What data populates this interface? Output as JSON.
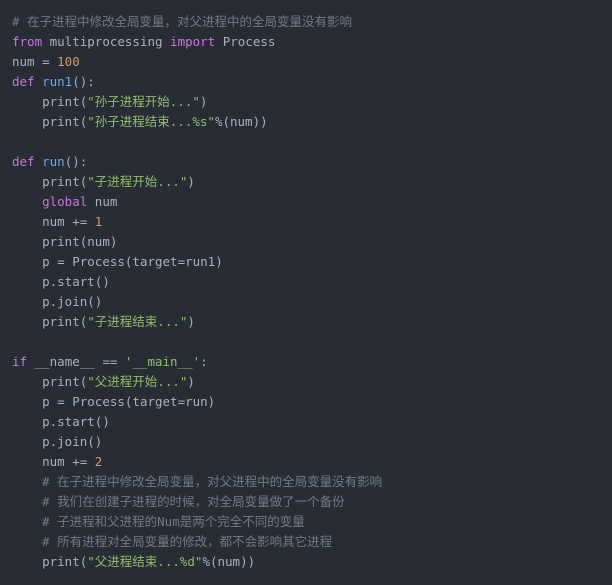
{
  "editor": {
    "background_color": "#282c34",
    "language": "python",
    "colors": {
      "comment": "#727a86",
      "keyword": "#c678dd",
      "function": "#61afef",
      "string": "#8fbf6b",
      "number": "#d19a66",
      "default_text": "#a9b1c0"
    }
  },
  "code": {
    "lines": [
      {
        "n": 1,
        "indent": 0,
        "tokens": [
          {
            "t": "# 在子进程中修改全局变量，对父进程中的全局变量没有影响",
            "c": "cmt"
          }
        ]
      },
      {
        "n": 2,
        "indent": 0,
        "tokens": [
          {
            "t": "from",
            "c": "kw"
          },
          {
            "t": " multiprocessing ",
            "c": "def"
          },
          {
            "t": "import",
            "c": "kw"
          },
          {
            "t": " Process",
            "c": "def"
          }
        ]
      },
      {
        "n": 3,
        "indent": 0,
        "tokens": [
          {
            "t": "num = ",
            "c": "def"
          },
          {
            "t": "100",
            "c": "num"
          }
        ]
      },
      {
        "n": 4,
        "indent": 0,
        "tokens": [
          {
            "t": "def",
            "c": "kw"
          },
          {
            "t": " ",
            "c": "def"
          },
          {
            "t": "run1",
            "c": "fn"
          },
          {
            "t": "():",
            "c": "def"
          }
        ]
      },
      {
        "n": 5,
        "indent": 1,
        "tokens": [
          {
            "t": "print(",
            "c": "def"
          },
          {
            "t": "\"孙子进程开始...\"",
            "c": "str"
          },
          {
            "t": ")",
            "c": "def"
          }
        ]
      },
      {
        "n": 6,
        "indent": 1,
        "tokens": [
          {
            "t": "print(",
            "c": "def"
          },
          {
            "t": "\"孙子进程结束...%s\"",
            "c": "str"
          },
          {
            "t": "%(num))",
            "c": "def"
          }
        ]
      },
      {
        "n": 7,
        "indent": 0,
        "tokens": []
      },
      {
        "n": 8,
        "indent": 0,
        "tokens": [
          {
            "t": "def",
            "c": "kw"
          },
          {
            "t": " ",
            "c": "def"
          },
          {
            "t": "run",
            "c": "fn"
          },
          {
            "t": "():",
            "c": "def"
          }
        ]
      },
      {
        "n": 9,
        "indent": 1,
        "tokens": [
          {
            "t": "print(",
            "c": "def"
          },
          {
            "t": "\"子进程开始...\"",
            "c": "str"
          },
          {
            "t": ")",
            "c": "def"
          }
        ]
      },
      {
        "n": 10,
        "indent": 1,
        "tokens": [
          {
            "t": "global",
            "c": "kw"
          },
          {
            "t": " num",
            "c": "def"
          }
        ]
      },
      {
        "n": 11,
        "indent": 1,
        "tokens": [
          {
            "t": "num += ",
            "c": "def"
          },
          {
            "t": "1",
            "c": "num"
          }
        ]
      },
      {
        "n": 12,
        "indent": 1,
        "tokens": [
          {
            "t": "print(num)",
            "c": "def"
          }
        ]
      },
      {
        "n": 13,
        "indent": 1,
        "tokens": [
          {
            "t": "p = Process(target=run1)",
            "c": "def"
          }
        ]
      },
      {
        "n": 14,
        "indent": 1,
        "tokens": [
          {
            "t": "p.start()",
            "c": "def"
          }
        ]
      },
      {
        "n": 15,
        "indent": 1,
        "tokens": [
          {
            "t": "p.join()",
            "c": "def"
          }
        ]
      },
      {
        "n": 16,
        "indent": 1,
        "tokens": [
          {
            "t": "print(",
            "c": "def"
          },
          {
            "t": "\"子进程结束...\"",
            "c": "str"
          },
          {
            "t": ")",
            "c": "def"
          }
        ]
      },
      {
        "n": 17,
        "indent": 0,
        "tokens": []
      },
      {
        "n": 18,
        "indent": 0,
        "tokens": [
          {
            "t": "if",
            "c": "kw"
          },
          {
            "t": " __name__ == ",
            "c": "def"
          },
          {
            "t": "'__main__'",
            "c": "str"
          },
          {
            "t": ":",
            "c": "def"
          }
        ]
      },
      {
        "n": 19,
        "indent": 1,
        "tokens": [
          {
            "t": "print(",
            "c": "def"
          },
          {
            "t": "\"父进程开始...\"",
            "c": "str"
          },
          {
            "t": ")",
            "c": "def"
          }
        ]
      },
      {
        "n": 20,
        "indent": 1,
        "tokens": [
          {
            "t": "p = Process(target=run)",
            "c": "def"
          }
        ]
      },
      {
        "n": 21,
        "indent": 1,
        "tokens": [
          {
            "t": "p.start()",
            "c": "def"
          }
        ]
      },
      {
        "n": 22,
        "indent": 1,
        "tokens": [
          {
            "t": "p.join()",
            "c": "def"
          }
        ]
      },
      {
        "n": 23,
        "indent": 1,
        "tokens": [
          {
            "t": "num += ",
            "c": "def"
          },
          {
            "t": "2",
            "c": "num"
          }
        ]
      },
      {
        "n": 24,
        "indent": 1,
        "tokens": [
          {
            "t": "# 在子进程中修改全局变量，对父进程中的全局变量没有影响",
            "c": "cmt"
          }
        ]
      },
      {
        "n": 25,
        "indent": 1,
        "tokens": [
          {
            "t": "# 我们在创建子进程的时候，对全局变量做了一个备份",
            "c": "cmt"
          }
        ]
      },
      {
        "n": 26,
        "indent": 1,
        "tokens": [
          {
            "t": "# 子进程和父进程的Num是两个完全不同的变量",
            "c": "cmt"
          }
        ]
      },
      {
        "n": 27,
        "indent": 1,
        "tokens": [
          {
            "t": "# 所有进程对全局变量的修改，都不会影响其它进程",
            "c": "cmt"
          }
        ]
      },
      {
        "n": 28,
        "indent": 1,
        "tokens": [
          {
            "t": "print(",
            "c": "def"
          },
          {
            "t": "\"父进程结束...%d\"",
            "c": "str"
          },
          {
            "t": "%(num))",
            "c": "def"
          }
        ]
      }
    ]
  }
}
